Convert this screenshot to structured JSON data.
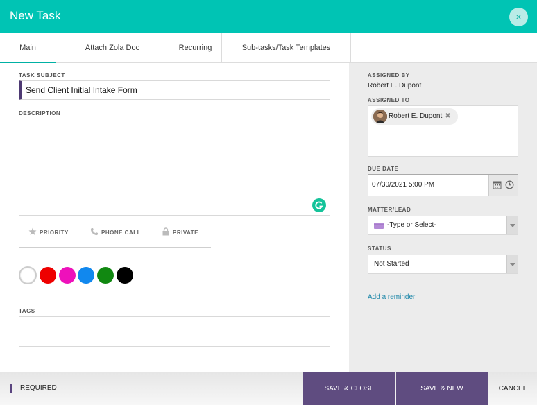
{
  "header": {
    "title": "New Task",
    "close_glyph": "×"
  },
  "tabs": [
    {
      "label": "Main"
    },
    {
      "label": "Attach Zola Doc"
    },
    {
      "label": "Recurring"
    },
    {
      "label": "Sub-tasks/Task Templates"
    }
  ],
  "form": {
    "subject_label": "TASK SUBJECT",
    "subject_value": "Send Client Initial Intake Form",
    "description_label": "DESCRIPTION",
    "description_value": "",
    "options": {
      "priority": "PRIORITY",
      "phone_call": "PHONE CALL",
      "private": "PRIVATE"
    },
    "colors": [
      "#ffffff",
      "#ee0000",
      "#ee11bb",
      "#1188ee",
      "#118811",
      "#000000"
    ],
    "tags_label": "TAGS"
  },
  "sidebar": {
    "assigned_by_label": "ASSIGNED BY",
    "assigned_by_value": "Robert E. Dupont",
    "assigned_to_label": "ASSIGNED TO",
    "assignee_chip": "Robert E. Dupont",
    "chip_remove_glyph": "✖",
    "due_date_label": "DUE DATE",
    "due_date_value": "07/30/2021 5:00 PM",
    "matter_label": "MATTER/LEAD",
    "matter_value": "-Type or Select-",
    "status_label": "STATUS",
    "status_value": "Not Started",
    "reminder_link": "Add a reminder"
  },
  "footer": {
    "required_label": "REQUIRED",
    "save_close": "SAVE & CLOSE",
    "save_new": "SAVE & NEW",
    "cancel": "CANCEL"
  },
  "colors": {
    "header": "#00c4b4",
    "accent": "#5f4c80",
    "link": "#1b86a8"
  }
}
